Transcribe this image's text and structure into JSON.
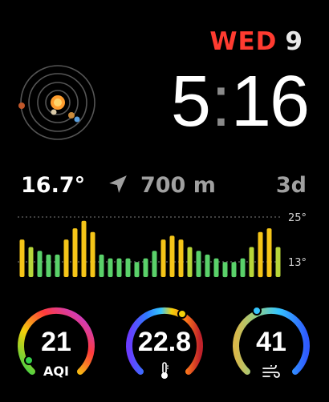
{
  "date": {
    "weekday": "WED",
    "day": "9"
  },
  "time": {
    "hours": "5",
    "minutes": "16"
  },
  "info": {
    "temperature": "16.7°",
    "distance": "700 m",
    "period": "3d"
  },
  "chart_data": {
    "type": "bar",
    "ymax_label": "25°",
    "ymin_label": "13°",
    "ylim": [
      10,
      26
    ],
    "values": [
      20,
      18,
      17,
      16,
      16,
      20,
      23,
      25,
      22,
      16,
      15,
      15,
      15,
      14,
      15,
      17,
      20,
      21,
      20,
      18,
      17,
      16,
      15,
      14,
      14,
      15,
      18,
      22,
      23,
      18
    ],
    "colors": {
      "warm": "#f5c518",
      "mid": "#b7d63a",
      "cool": "#5ad16a"
    }
  },
  "gauges": [
    {
      "value": "21",
      "label": "AQI",
      "icon": "aqi-icon"
    },
    {
      "value": "22.8",
      "label": "",
      "icon": "thermometer-icon"
    },
    {
      "value": "41",
      "label": "",
      "icon": "wind-icon"
    }
  ],
  "solar_system": {
    "icon": "solar-system-icon"
  }
}
